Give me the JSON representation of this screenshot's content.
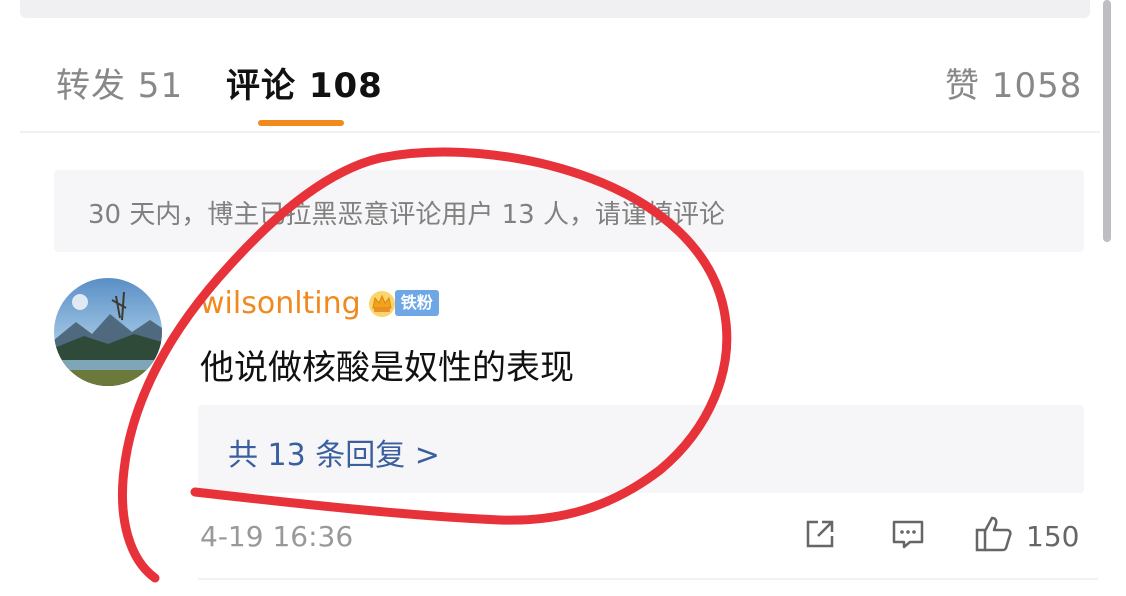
{
  "tabs": {
    "repost": "转发 51",
    "comments": "评论 108",
    "likes": "赞 1058"
  },
  "notice": {
    "text": "30 天内，博主已拉黑恶意评论用户 13 人，请谨慎评论"
  },
  "comment": {
    "username": "wilsonlting",
    "badge_label": "铁粉",
    "text": "他说做核酸是奴性的表现",
    "replies_link": "共 13 条回复 >",
    "timestamp": "4-19 16:36",
    "like_count": "150"
  },
  "icons": {
    "share": "share-icon",
    "comment": "comment-icon",
    "like": "thumbs-up-icon",
    "crown": "crown-badge-icon"
  },
  "colors": {
    "accent_orange": "#f08a1f",
    "link_blue": "#3a5f9f",
    "annotation_red": "#e8323a",
    "badge_blue": "#6fa7e6"
  }
}
